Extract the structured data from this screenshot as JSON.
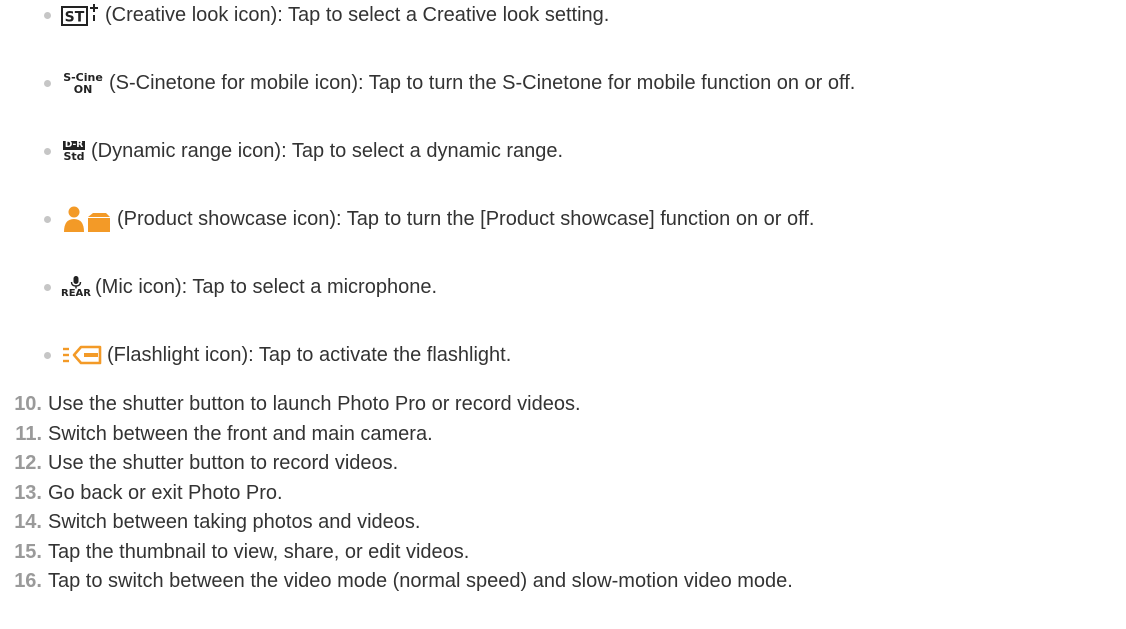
{
  "bullets": [
    {
      "icon": "creative-look-icon",
      "icon_text": "ST",
      "text": "(Creative look icon): Tap to select a Creative look setting."
    },
    {
      "icon": "s-cinetone-icon",
      "icon_text_top": "S-Cine",
      "icon_text_bottom": "ON",
      "text": "(S-Cinetone for mobile icon): Tap to turn the S-Cinetone for mobile function on or off."
    },
    {
      "icon": "dynamic-range-icon",
      "icon_text_top": "D-R",
      "icon_text_bottom": "Std",
      "text": "(Dynamic range icon): Tap to select a dynamic range."
    },
    {
      "icon": "product-showcase-icon",
      "text": "(Product showcase icon): Tap to turn the [Product showcase] function on or off."
    },
    {
      "icon": "mic-icon",
      "icon_text": "REAR",
      "text": "(Mic icon): Tap to select a microphone."
    },
    {
      "icon": "flashlight-icon",
      "text": "(Flashlight icon): Tap to activate the flashlight."
    }
  ],
  "steps": [
    {
      "num": "10.",
      "text": "Use the shutter button to launch Photo Pro or record videos."
    },
    {
      "num": "11.",
      "text": "Switch between the front and main camera."
    },
    {
      "num": "12.",
      "text": "Use the shutter button to record videos."
    },
    {
      "num": "13.",
      "text": "Go back or exit Photo Pro."
    },
    {
      "num": "14.",
      "text": "Switch between taking photos and videos."
    },
    {
      "num": "15.",
      "text": "Tap the thumbnail to view, share, or edit videos."
    },
    {
      "num": "16.",
      "text": "Tap to switch between the video mode (normal speed) and slow-motion video mode."
    }
  ],
  "colors": {
    "icon_orange": "#f39a27",
    "step_number": "#9a9a9a",
    "text": "#333333"
  }
}
